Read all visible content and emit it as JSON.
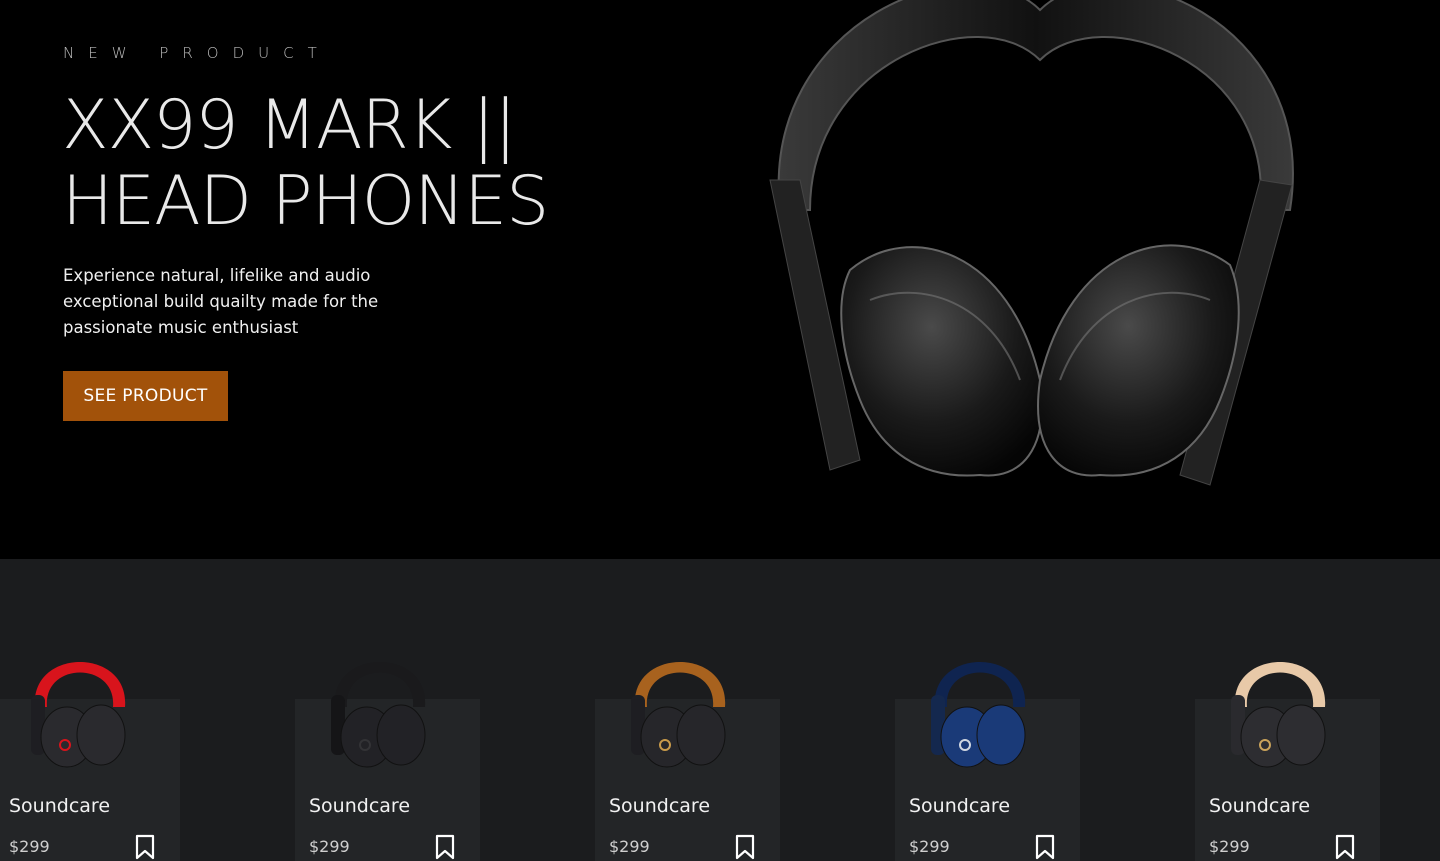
{
  "hero": {
    "eyebrow": "NEW PRODUCT",
    "title_line1": "XX99 MARK ||",
    "title_line2": "HEAD PHONES",
    "description": "Experience natural, lifelike and audio exceptional build quailty made for the passionate music enthusiast",
    "cta_label": "SEE PRODUCT",
    "accent": "#a2520a",
    "image_icon": "headphones-image"
  },
  "products": [
    {
      "name": "Soundcare",
      "price": "$299",
      "color_body": "#1e1e22",
      "color_band": "#d8141c",
      "color_cup": "#2a2a2e",
      "logo": "#d8141c",
      "action_icon": "bookmark-icon"
    },
    {
      "name": "Soundcare",
      "price": "$299",
      "color_body": "#151517",
      "color_band": "#1a1a1c",
      "color_cup": "#222226",
      "logo": "#333336",
      "action_icon": "bookmark-icon"
    },
    {
      "name": "Soundcare",
      "price": "$299",
      "color_body": "#1e1e22",
      "color_band": "#a8621e",
      "color_cup": "#26262a",
      "logo": "#c89a4a",
      "action_icon": "bookmark-icon"
    },
    {
      "name": "Soundcare",
      "price": "$299",
      "color_body": "#14284e",
      "color_band": "#0f2450",
      "color_cup": "#1a3a78",
      "logo": "#cfd6e0",
      "action_icon": "bookmark-icon"
    },
    {
      "name": "Soundcare",
      "price": "$299",
      "color_body": "#2a2a2e",
      "color_band": "#e8c9a8",
      "color_cup": "#2d2d31",
      "logo": "#c9a25a",
      "action_icon": "bookmark-icon"
    }
  ]
}
